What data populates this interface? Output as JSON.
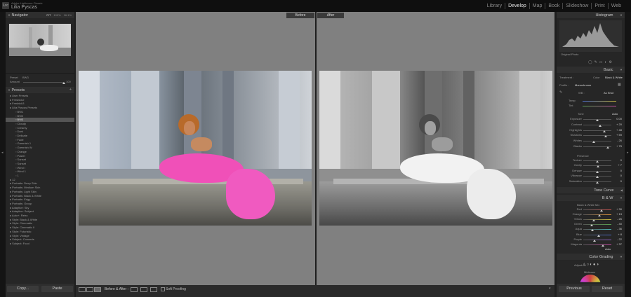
{
  "header": {
    "app_name": "Adobe Lightroom Classic",
    "user_name": "Lilia Pyscas",
    "modules": [
      "Library",
      "Develop",
      "Map",
      "Book",
      "Slideshow",
      "Print",
      "Web"
    ],
    "active_module": "Develop"
  },
  "navigator": {
    "title": "Navigator",
    "zoom_options": [
      "FIT",
      "100%",
      "16:1%"
    ]
  },
  "preset_controls": {
    "preset_label": "Preset",
    "preset_value": "BW3",
    "amount_label": "Amount",
    "amount_value": "100",
    "amount_level": 1.0
  },
  "presets": {
    "title": "Presets",
    "items": [
      {
        "label": "User Presets",
        "indent": 0,
        "selected": false
      },
      {
        "label": "Freshick2",
        "indent": 0,
        "selected": false
      },
      {
        "label": "Freshick3",
        "indent": 0,
        "selected": false
      },
      {
        "label": "Lilia Pyscas Presets",
        "indent": 0,
        "selected": false
      },
      {
        "label": "BW1",
        "indent": 1,
        "selected": false
      },
      {
        "label": "BW2",
        "indent": 1,
        "selected": false
      },
      {
        "label": "BW3",
        "indent": 1,
        "selected": true
      },
      {
        "label": "Cloudy",
        "indent": 1,
        "selected": false
      },
      {
        "label": "Creamy",
        "indent": 1,
        "selected": false
      },
      {
        "label": "Dark",
        "indent": 1,
        "selected": false
      },
      {
        "label": "Delicate",
        "indent": 1,
        "selected": false
      },
      {
        "label": "Fade",
        "indent": 1,
        "selected": false
      },
      {
        "label": "Greenish 1",
        "indent": 1,
        "selected": false
      },
      {
        "label": "Greenish W",
        "indent": 1,
        "selected": false
      },
      {
        "label": "Orange",
        "indent": 1,
        "selected": false
      },
      {
        "label": "Pastel",
        "indent": 1,
        "selected": false
      },
      {
        "label": "Sunset",
        "indent": 1,
        "selected": false
      },
      {
        "label": "Sunset",
        "indent": 1,
        "selected": false
      },
      {
        "label": "Wind I",
        "indent": 1,
        "selected": false
      },
      {
        "label": "Wind 1",
        "indent": 1,
        "selected": false
      },
      {
        "label": "1",
        "indent": 1,
        "selected": false
      },
      {
        "label": "12",
        "indent": 0,
        "selected": false
      },
      {
        "label": "Portraits: Deep Skin",
        "indent": 0,
        "selected": false
      },
      {
        "label": "Portraits: Medium Skin",
        "indent": 0,
        "selected": false
      },
      {
        "label": "Portraits: Light Skin",
        "indent": 0,
        "selected": false
      },
      {
        "label": "Portraits: Black & White",
        "indent": 0,
        "selected": false
      },
      {
        "label": "Portraits: Edgy",
        "indent": 0,
        "selected": false
      },
      {
        "label": "Portraits: Group",
        "indent": 0,
        "selected": false
      },
      {
        "label": "Adaptive: Sky",
        "indent": 0,
        "selected": false
      },
      {
        "label": "Adaptive: Subject",
        "indent": 0,
        "selected": false
      },
      {
        "label": "Auto+: Retro",
        "indent": 0,
        "selected": false
      },
      {
        "label": "Style: Black & White",
        "indent": 0,
        "selected": false
      },
      {
        "label": "Style: Cinematic",
        "indent": 0,
        "selected": false
      },
      {
        "label": "Style: Cinematic II",
        "indent": 0,
        "selected": false
      },
      {
        "label": "Style: Futuristic",
        "indent": 0,
        "selected": false
      },
      {
        "label": "Style: Vintage",
        "indent": 0,
        "selected": false
      },
      {
        "label": "Subject: Concerts",
        "indent": 0,
        "selected": false
      },
      {
        "label": "Subject: Food",
        "indent": 0,
        "selected": false
      }
    ]
  },
  "left_buttons": {
    "copy": "Copy...",
    "paste": "Paste"
  },
  "viewer": {
    "before_label": "Before",
    "after_label": "After"
  },
  "toolbar": {
    "before_after": "Before & After :",
    "soft_proofing": "Soft Proofing"
  },
  "histogram": {
    "title": "Histogram",
    "original_photo": "Original Photo"
  },
  "basic": {
    "title": "Basic",
    "treatment_label": "Treatment :",
    "color_option": "Color",
    "bw_option": "Black & White",
    "profile_label": "Profile :",
    "profile_value": "Monochrome",
    "wb_label": "WB :",
    "wb_value": "As Shot",
    "temp_label": "Temp",
    "tint_label": "Tint",
    "tone_label": "Tone",
    "auto_label": "Auto",
    "sliders": [
      {
        "label": "Exposure",
        "value": "0.00",
        "level": 0.5
      },
      {
        "label": "Contrast",
        "value": "+ 20",
        "level": 0.6
      },
      {
        "label": "Highlights",
        "value": "+ 48",
        "level": 0.74
      },
      {
        "label": "Shadows",
        "value": "+ 59",
        "level": 0.8
      },
      {
        "label": "Whites",
        "value": "- 26",
        "level": 0.37
      },
      {
        "label": "Blacks",
        "value": "+ 75",
        "level": 0.87
      }
    ],
    "presence_label": "Presence",
    "presence_sliders": [
      {
        "label": "Texture",
        "value": "0",
        "level": 0.5
      },
      {
        "label": "Clarity",
        "value": "+ 7",
        "level": 0.53
      },
      {
        "label": "Dehaze",
        "value": "0",
        "level": 0.5
      },
      {
        "label": "Vibrance",
        "value": "0",
        "level": 0.5
      },
      {
        "label": "Saturation",
        "value": "0",
        "level": 0.5
      }
    ]
  },
  "tone_curve": {
    "title": "Tone Curve"
  },
  "bw_panel": {
    "title": "B & W",
    "mix_label": "Black & White Mix",
    "auto_label": "Auto",
    "sliders": [
      {
        "label": "Red",
        "value": "+ 30",
        "level": 0.65,
        "color": "#c0504d"
      },
      {
        "label": "Orange",
        "value": "+ 13",
        "level": 0.57,
        "color": "#d08a3a"
      },
      {
        "label": "Yellow",
        "value": "- 26",
        "level": 0.37,
        "color": "#c8b83a"
      },
      {
        "label": "Green",
        "value": "- 40",
        "level": 0.3,
        "color": "#5aa050"
      },
      {
        "label": "Aqua",
        "value": "- 36",
        "level": 0.32,
        "color": "#4ab0b0"
      },
      {
        "label": "Blue",
        "value": "+ 8",
        "level": 0.54,
        "color": "#4a6ac8"
      },
      {
        "label": "Purple",
        "value": "- 22",
        "level": 0.39,
        "color": "#8a5ac0"
      },
      {
        "label": "Magenta",
        "value": "+ 37",
        "level": 0.69,
        "color": "#c04aa0"
      }
    ]
  },
  "color_grading": {
    "title": "Color Grading",
    "adjust_label": "Adjust :",
    "midtones_label": "Midtones"
  },
  "right_buttons": {
    "previous": "Previous",
    "reset": "Reset"
  },
  "colors": {
    "accent": "#e6e6e6",
    "canvas_gray": "#808080",
    "dress_pink": "#f050b8"
  }
}
